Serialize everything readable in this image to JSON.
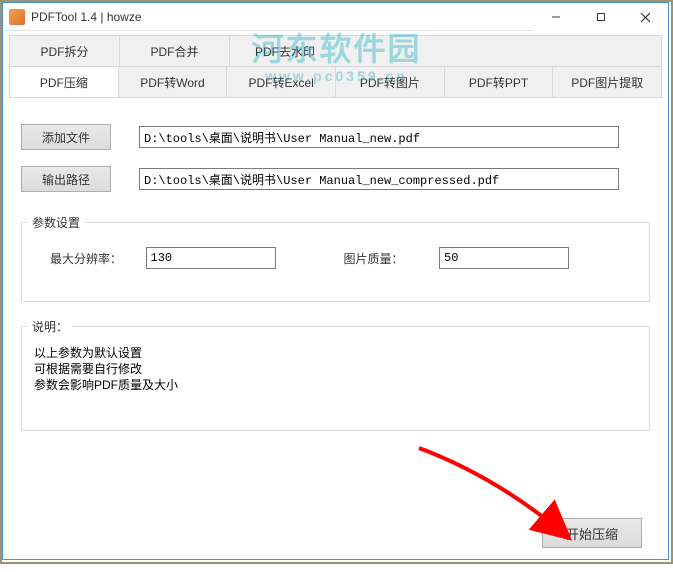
{
  "watermark": {
    "main": "河东软件园",
    "sub": "www.pc0359.cn"
  },
  "window": {
    "title": "PDFTool 1.4 | howze"
  },
  "tabs_row1": {
    "t0": "PDF拆分",
    "t1": "PDF合并",
    "t2": "PDF去水印"
  },
  "tabs_row2": {
    "t0": "PDF压缩",
    "t1": "PDF转Word",
    "t2": "PDF转Excel",
    "t3": "PDF转图片",
    "t4": "PDF转PPT",
    "t5": "PDF图片提取"
  },
  "buttons": {
    "add_file": "添加文件",
    "output_path": "输出路径",
    "start": "开始压缩"
  },
  "inputs": {
    "file_path": "D:\\tools\\桌面\\说明书\\User Manual_new.pdf",
    "output_path": "D:\\tools\\桌面\\说明书\\User Manual_new_compressed.pdf",
    "max_res": "130",
    "quality": "50"
  },
  "params": {
    "legend": "参数设置",
    "max_res_label": "最大分辨率：",
    "quality_label": "图片质量："
  },
  "notes": {
    "legend": "说明：",
    "line1": "以上参数为默认设置",
    "line2": "可根据需要自行修改",
    "line3": "参数会影响PDF质量及大小"
  }
}
